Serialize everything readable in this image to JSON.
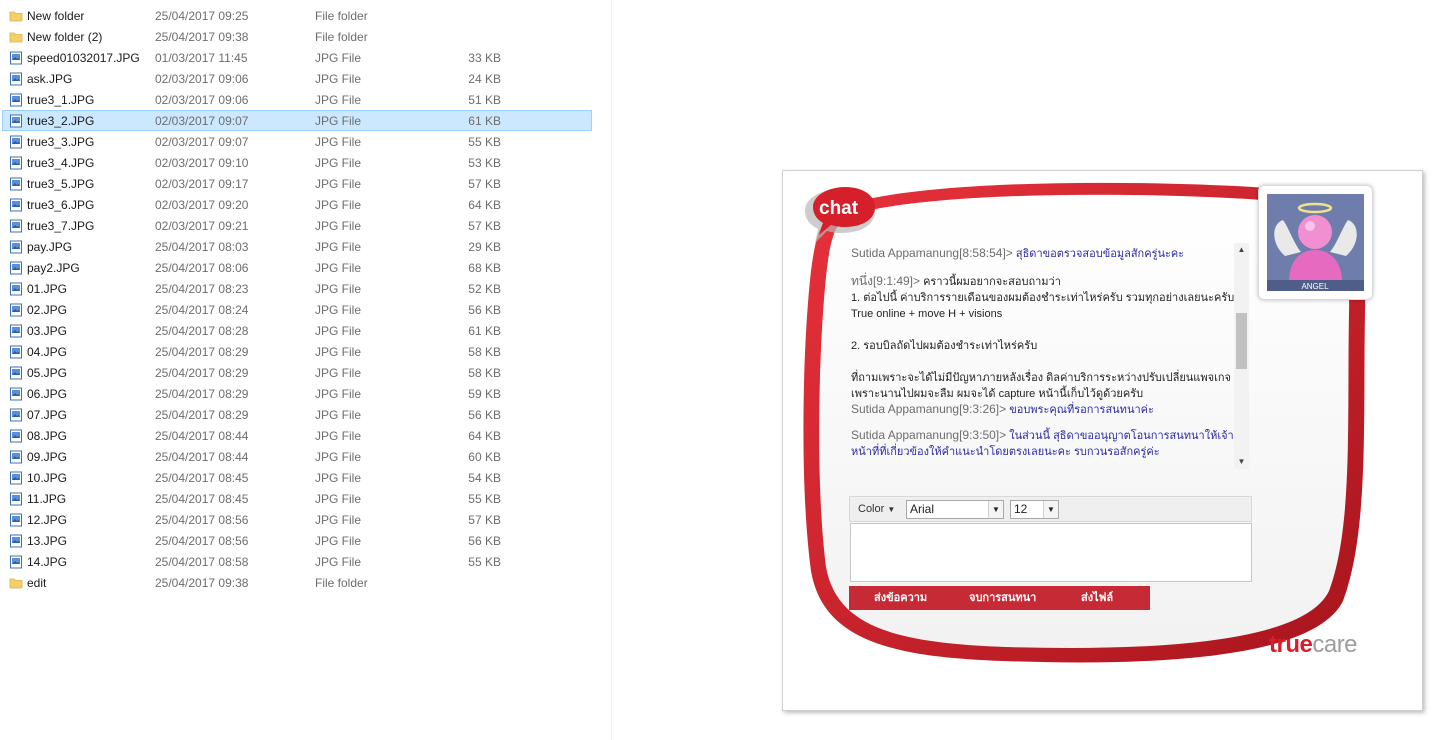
{
  "explorer": {
    "files": [
      {
        "name": "New folder",
        "date": "25/04/2017 09:25",
        "type": "File folder",
        "size": "",
        "icon": "folder-icon",
        "selected": false
      },
      {
        "name": "New folder (2)",
        "date": "25/04/2017 09:38",
        "type": "File folder",
        "size": "",
        "icon": "folder-icon",
        "selected": false
      },
      {
        "name": "speed01032017.JPG",
        "date": "01/03/2017 11:45",
        "type": "JPG File",
        "size": "33 KB",
        "icon": "image-file-icon",
        "selected": false
      },
      {
        "name": "ask.JPG",
        "date": "02/03/2017 09:06",
        "type": "JPG File",
        "size": "24 KB",
        "icon": "image-file-icon",
        "selected": false
      },
      {
        "name": "true3_1.JPG",
        "date": "02/03/2017 09:06",
        "type": "JPG File",
        "size": "51 KB",
        "icon": "image-file-icon",
        "selected": false
      },
      {
        "name": "true3_2.JPG",
        "date": "02/03/2017 09:07",
        "type": "JPG File",
        "size": "61 KB",
        "icon": "image-file-icon",
        "selected": true
      },
      {
        "name": "true3_3.JPG",
        "date": "02/03/2017 09:07",
        "type": "JPG File",
        "size": "55 KB",
        "icon": "image-file-icon",
        "selected": false
      },
      {
        "name": "true3_4.JPG",
        "date": "02/03/2017 09:10",
        "type": "JPG File",
        "size": "53 KB",
        "icon": "image-file-icon",
        "selected": false
      },
      {
        "name": "true3_5.JPG",
        "date": "02/03/2017 09:17",
        "type": "JPG File",
        "size": "57 KB",
        "icon": "image-file-icon",
        "selected": false
      },
      {
        "name": "true3_6.JPG",
        "date": "02/03/2017 09:20",
        "type": "JPG File",
        "size": "64 KB",
        "icon": "image-file-icon",
        "selected": false
      },
      {
        "name": "true3_7.JPG",
        "date": "02/03/2017 09:21",
        "type": "JPG File",
        "size": "57 KB",
        "icon": "image-file-icon",
        "selected": false
      },
      {
        "name": "pay.JPG",
        "date": "25/04/2017 08:03",
        "type": "JPG File",
        "size": "29 KB",
        "icon": "image-file-icon",
        "selected": false
      },
      {
        "name": "pay2.JPG",
        "date": "25/04/2017 08:06",
        "type": "JPG File",
        "size": "68 KB",
        "icon": "image-file-icon",
        "selected": false
      },
      {
        "name": "01.JPG",
        "date": "25/04/2017 08:23",
        "type": "JPG File",
        "size": "52 KB",
        "icon": "image-file-icon",
        "selected": false
      },
      {
        "name": "02.JPG",
        "date": "25/04/2017 08:24",
        "type": "JPG File",
        "size": "56 KB",
        "icon": "image-file-icon",
        "selected": false
      },
      {
        "name": "03.JPG",
        "date": "25/04/2017 08:28",
        "type": "JPG File",
        "size": "61 KB",
        "icon": "image-file-icon",
        "selected": false
      },
      {
        "name": "04.JPG",
        "date": "25/04/2017 08:29",
        "type": "JPG File",
        "size": "58 KB",
        "icon": "image-file-icon",
        "selected": false
      },
      {
        "name": "05.JPG",
        "date": "25/04/2017 08:29",
        "type": "JPG File",
        "size": "58 KB",
        "icon": "image-file-icon",
        "selected": false
      },
      {
        "name": "06.JPG",
        "date": "25/04/2017 08:29",
        "type": "JPG File",
        "size": "59 KB",
        "icon": "image-file-icon",
        "selected": false
      },
      {
        "name": "07.JPG",
        "date": "25/04/2017 08:29",
        "type": "JPG File",
        "size": "56 KB",
        "icon": "image-file-icon",
        "selected": false
      },
      {
        "name": "08.JPG",
        "date": "25/04/2017 08:44",
        "type": "JPG File",
        "size": "64 KB",
        "icon": "image-file-icon",
        "selected": false
      },
      {
        "name": "09.JPG",
        "date": "25/04/2017 08:44",
        "type": "JPG File",
        "size": "60 KB",
        "icon": "image-file-icon",
        "selected": false
      },
      {
        "name": "10.JPG",
        "date": "25/04/2017 08:45",
        "type": "JPG File",
        "size": "54 KB",
        "icon": "image-file-icon",
        "selected": false
      },
      {
        "name": "11.JPG",
        "date": "25/04/2017 08:45",
        "type": "JPG File",
        "size": "55 KB",
        "icon": "image-file-icon",
        "selected": false
      },
      {
        "name": "12.JPG",
        "date": "25/04/2017 08:56",
        "type": "JPG File",
        "size": "57 KB",
        "icon": "image-file-icon",
        "selected": false
      },
      {
        "name": "13.JPG",
        "date": "25/04/2017 08:56",
        "type": "JPG File",
        "size": "56 KB",
        "icon": "image-file-icon",
        "selected": false
      },
      {
        "name": "14.JPG",
        "date": "25/04/2017 08:58",
        "type": "JPG File",
        "size": "55 KB",
        "icon": "image-file-icon",
        "selected": false
      },
      {
        "name": "edit",
        "date": "25/04/2017 09:38",
        "type": "File folder",
        "size": "",
        "icon": "folder-icon",
        "selected": false
      }
    ]
  },
  "chat": {
    "badge": "chat",
    "avatar_label": "ANGEL",
    "messages": [
      {
        "sender": "Sutida Appamanung[8:58:54]>",
        "text": "สุธิดาขอตรวจสอบข้อมูลสักครู่นะคะ",
        "role": "agent"
      },
      {
        "sender": "ทนึ่ง[9:1:49]>",
        "text": "คราวนี้ผมอยากจะสอบถามว่า\n1. ต่อไปนี้ ค่าบริการรายเดือนของผมต้องชำระเท่าไหร่ครับ รวมทุกอย่างเลยนะครับ True online + move H + visions\n\n2. รอบบิลถัดไปผมต้องชำระเท่าไหร่ครับ\n\nที่ถามเพราะจะได้ไม่มีปัญหาภายหลังเรื่อง ดิลค่าบริการระหว่างปรับเปลี่ยนแพจเกจ เพราะนานไปผมจะลืม ผมจะได้ capture หน้านี้เก็บไว้ดูด้วยครับ",
        "role": "customer"
      },
      {
        "sender": "Sutida Appamanung[9:3:26]>",
        "text": "ขอบพระคุณที่รอการสนทนาค่ะ",
        "role": "agent"
      },
      {
        "sender": "Sutida Appamanung[9:3:50]>",
        "text": "ในส่วนนี้ สุธิดาขออนุญาตโอนการสนทนาให้เจ้าหน้าที่ที่เกี่ยวข้องให้คำแนะนำโดยตรงเลยนะคะ รบกวนรอสักครู่ค่ะ",
        "role": "agent"
      }
    ],
    "toolbar": {
      "color_label": "Color",
      "font_value": "Arial",
      "size_value": "12"
    },
    "input_value": "",
    "actions": {
      "send": "ส่งข้อความ",
      "end": "จบการสนทนา",
      "file": "ส่งไฟล์"
    },
    "logo": {
      "part1": "true",
      "part2": "care"
    },
    "colors": {
      "brand_red": "#d71f2b",
      "selection": "#cce8ff",
      "agent_text": "#2a2aa6"
    }
  }
}
